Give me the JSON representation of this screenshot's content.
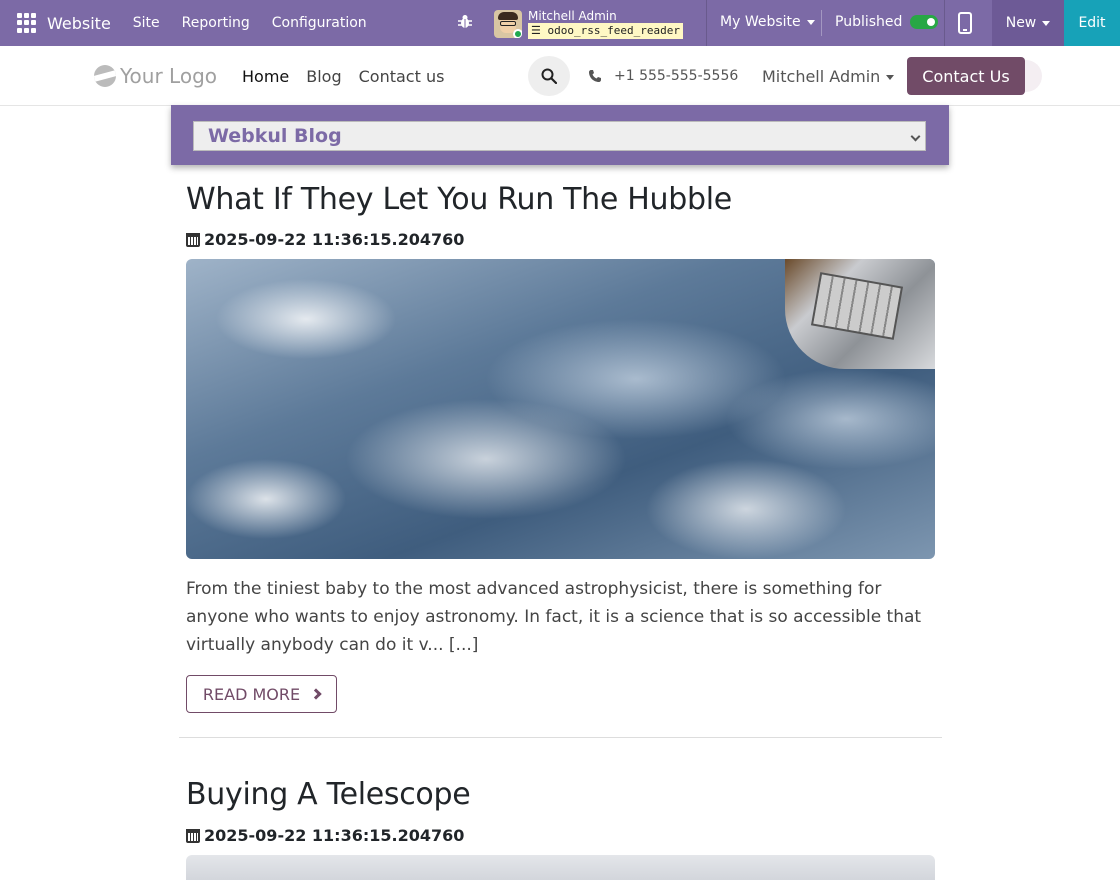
{
  "admin_bar": {
    "app_name": "Website",
    "menu": [
      "Site",
      "Reporting",
      "Configuration"
    ],
    "user_name": "Mitchell Admin",
    "db_name": "odoo_rss_feed_reader",
    "my_website_label": "My Website",
    "published_label": "Published",
    "published": true,
    "new_label": "New",
    "edit_label": "Edit",
    "colors": {
      "bar": "#7c6aa6",
      "edit": "#17a2b8",
      "toggle_on": "#28a745"
    }
  },
  "site_header": {
    "logo_text": "Your Logo",
    "nav": [
      "Home",
      "Blog",
      "Contact us"
    ],
    "active_nav": "Home",
    "phone": "+1 555-555-5556",
    "user_menu": "Mitchell Admin",
    "contact_button": "Contact Us",
    "colors": {
      "primary": "#714b67"
    }
  },
  "blog_selector": {
    "selected": "Webkul Blog"
  },
  "posts": [
    {
      "title": "What If They Let You Run The Hubble",
      "date": "2025-09-22 11:36:15.204760",
      "image_icon": "earth-from-space-image",
      "excerpt": "From the tiniest baby to the most advanced astrophysicist, there is something for anyone who wants to enjoy astronomy. In fact, it is a science that is so accessible that virtually anybody can do it v... [...]",
      "read_more_label": "READ MORE"
    },
    {
      "title": "Buying A Telescope",
      "date": "2025-09-22 11:36:15.204760",
      "image_icon": "telescope-image"
    }
  ]
}
